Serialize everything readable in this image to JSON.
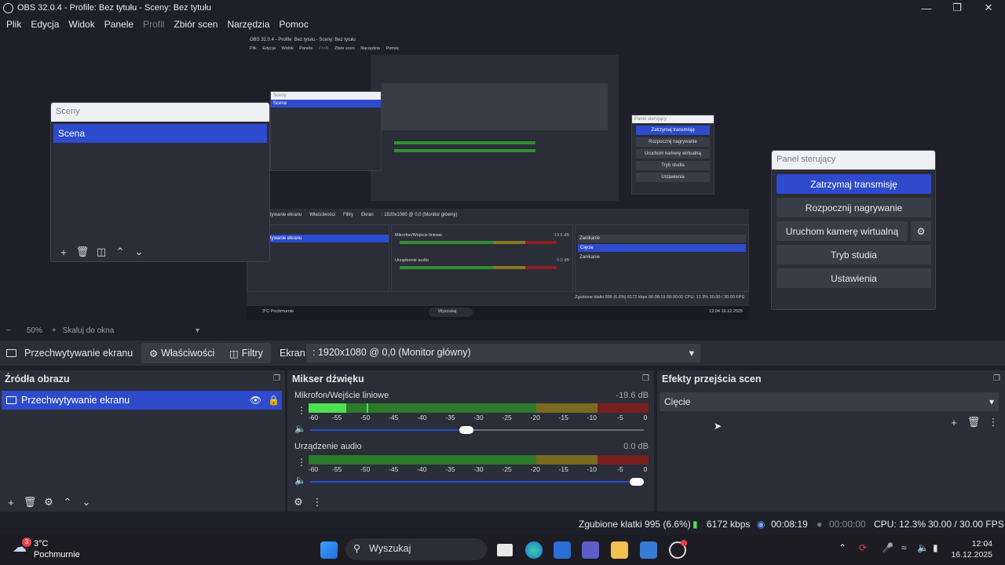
{
  "window": {
    "title": "OBS 32.0.4 - Profile: Bez tytułu - Sceny: Bez tytułu",
    "minimize_icon": "minimize-icon",
    "maximize_icon": "maximize-icon",
    "close_icon": "close-icon"
  },
  "menu": {
    "items": [
      "Plik",
      "Edycja",
      "Widok",
      "Panele",
      "Profil",
      "Zbiór scen",
      "Narzędzia",
      "Pomoc"
    ]
  },
  "preview": {
    "nested_title": "OBS 32.0.4 - Profile: Bez tytułu - Sceny: Bez tytułu",
    "nested_menu": [
      "Plik",
      "Edycja",
      "Widok",
      "Panele",
      "Profil",
      "Zbiór scen",
      "Narzędzia",
      "Pomoc"
    ],
    "nested_source_toolbar": [
      "Przechwytywanie ekranu",
      "Właściwości",
      "Filtry",
      "Ekran",
      ": 1920x1080 @ 0,0 (Monitor główny)"
    ],
    "nested_sources_item": "Przechwytywanie ekranu",
    "nested_mixer_ch1": "Mikrofon/Wejście liniowe",
    "nested_mixer_ch1_db": "-19.6 dB",
    "nested_mixer_ch2": "Urządzenie audio",
    "nested_mixer_ch2_db": "0.0 dB",
    "nested_transition": "Zanikanie",
    "nested_transition_options": [
      "Cięcie",
      "Zanikanie"
    ],
    "nested_status": "Zgubione klatki 995 (6.6%)   6172 kbps   00:08:19   00:00:00   CPU: 12.3%   30.00 / 30.00 FPS",
    "nested_search": "Wyszukaj",
    "nested_weather": "3°C Pochmurnie",
    "nested_clock": "12:04 16.12.2025",
    "nested_ctrl_buttons": [
      "Zatrzymaj transmisję",
      "Rozpocznij nagrywanie",
      "Uruchom kamerę wirtualną",
      "Tryb studia",
      "Ustawienia"
    ],
    "nested_panel_header": "Panel sterujący",
    "nested_scenes_header": "Sceny",
    "nested_scene_item": "Scena"
  },
  "scenes_window": {
    "header": "Sceny",
    "items": [
      "Scena"
    ],
    "tools": [
      "add-icon",
      "trash-icon",
      "filter-icon",
      "arrow-up-icon",
      "arrow-down-icon"
    ]
  },
  "controls_window": {
    "header": "Panel sterujący",
    "stop_stream": "Zatrzymaj transmisję",
    "start_recording": "Rozpocznij nagrywanie",
    "virtual_cam": "Uruchom kamerę wirtualną",
    "studio_mode": "Tryb studia",
    "settings": "Ustawienia",
    "settings_gear_icon": "gear-icon"
  },
  "zoom": {
    "minus": "−",
    "level": "50%",
    "plus": "+",
    "mode": "Skaluj do okna"
  },
  "source_toolbar": {
    "source_name": "Przechwytywanie ekranu",
    "properties": "Właściwości",
    "filters": "Filtry",
    "screen_label": "Ekran",
    "screen_value": ": 1920x1080 @ 0,0 (Monitor główny)"
  },
  "sources_dock": {
    "header": "Źródła obrazu",
    "items": [
      "Przechwytywanie ekranu"
    ]
  },
  "mixer_dock": {
    "header": "Mikser dźwięku",
    "channels": [
      {
        "name": "Mikrofon/Wejście liniowe",
        "db": "-19.6 dB",
        "level": 0.11,
        "peak": 0.17,
        "volume": 0.49
      },
      {
        "name": "Urządzenie audio",
        "db": "0.0 dB",
        "level": 0.0,
        "peak": 0.0,
        "volume": 1.0
      }
    ],
    "ticks": [
      "-60",
      "-55",
      "-50",
      "-45",
      "-40",
      "-35",
      "-30",
      "-25",
      "-20",
      "-15",
      "-10",
      "-5",
      "0"
    ]
  },
  "transitions_dock": {
    "header": "Efekty przejścia scen",
    "selected": "Cięcie"
  },
  "status": {
    "dropped": "Zgubione klatki 995 (6.6%)",
    "bitrate": "6172 kbps",
    "stream_time": "00:08:19",
    "rec_time": "00:00:00",
    "cpu": "CPU: 12.3%",
    "fps": "30.00 / 30.00 FPS"
  },
  "taskbar": {
    "weather_temp": "3°C",
    "weather_desc": "Pochmurnie",
    "weather_badge": "3",
    "search_placeholder": "Wyszukaj",
    "time": "12:04",
    "date": "16.12.2025"
  },
  "colors": {
    "accent": "#2d4bcc",
    "panel": "#2b2d38",
    "background": "#1e1f29"
  }
}
